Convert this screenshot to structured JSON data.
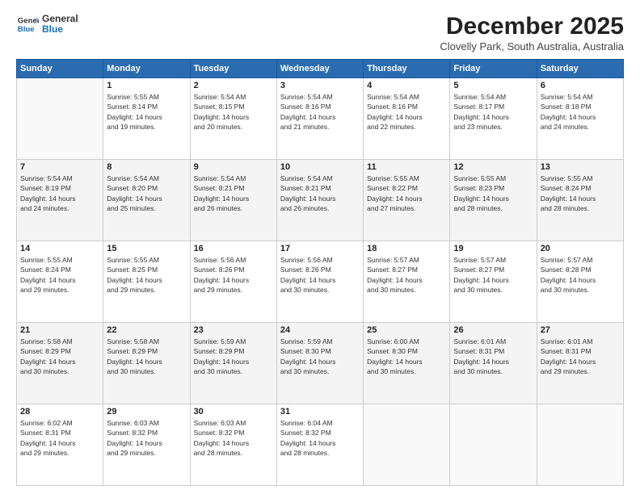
{
  "header": {
    "logo_line1": "General",
    "logo_line2": "Blue",
    "month": "December 2025",
    "location": "Clovelly Park, South Australia, Australia"
  },
  "days_of_week": [
    "Sunday",
    "Monday",
    "Tuesday",
    "Wednesday",
    "Thursday",
    "Friday",
    "Saturday"
  ],
  "weeks": [
    [
      {
        "num": "",
        "info": ""
      },
      {
        "num": "1",
        "info": "Sunrise: 5:55 AM\nSunset: 8:14 PM\nDaylight: 14 hours\nand 19 minutes."
      },
      {
        "num": "2",
        "info": "Sunrise: 5:54 AM\nSunset: 8:15 PM\nDaylight: 14 hours\nand 20 minutes."
      },
      {
        "num": "3",
        "info": "Sunrise: 5:54 AM\nSunset: 8:16 PM\nDaylight: 14 hours\nand 21 minutes."
      },
      {
        "num": "4",
        "info": "Sunrise: 5:54 AM\nSunset: 8:16 PM\nDaylight: 14 hours\nand 22 minutes."
      },
      {
        "num": "5",
        "info": "Sunrise: 5:54 AM\nSunset: 8:17 PM\nDaylight: 14 hours\nand 23 minutes."
      },
      {
        "num": "6",
        "info": "Sunrise: 5:54 AM\nSunset: 8:18 PM\nDaylight: 14 hours\nand 24 minutes."
      }
    ],
    [
      {
        "num": "7",
        "info": "Sunrise: 5:54 AM\nSunset: 8:19 PM\nDaylight: 14 hours\nand 24 minutes."
      },
      {
        "num": "8",
        "info": "Sunrise: 5:54 AM\nSunset: 8:20 PM\nDaylight: 14 hours\nand 25 minutes."
      },
      {
        "num": "9",
        "info": "Sunrise: 5:54 AM\nSunset: 8:21 PM\nDaylight: 14 hours\nand 26 minutes."
      },
      {
        "num": "10",
        "info": "Sunrise: 5:54 AM\nSunset: 8:21 PM\nDaylight: 14 hours\nand 26 minutes."
      },
      {
        "num": "11",
        "info": "Sunrise: 5:55 AM\nSunset: 8:22 PM\nDaylight: 14 hours\nand 27 minutes."
      },
      {
        "num": "12",
        "info": "Sunrise: 5:55 AM\nSunset: 8:23 PM\nDaylight: 14 hours\nand 28 minutes."
      },
      {
        "num": "13",
        "info": "Sunrise: 5:55 AM\nSunset: 8:24 PM\nDaylight: 14 hours\nand 28 minutes."
      }
    ],
    [
      {
        "num": "14",
        "info": "Sunrise: 5:55 AM\nSunset: 8:24 PM\nDaylight: 14 hours\nand 29 minutes."
      },
      {
        "num": "15",
        "info": "Sunrise: 5:55 AM\nSunset: 8:25 PM\nDaylight: 14 hours\nand 29 minutes."
      },
      {
        "num": "16",
        "info": "Sunrise: 5:56 AM\nSunset: 8:26 PM\nDaylight: 14 hours\nand 29 minutes."
      },
      {
        "num": "17",
        "info": "Sunrise: 5:56 AM\nSunset: 8:26 PM\nDaylight: 14 hours\nand 30 minutes."
      },
      {
        "num": "18",
        "info": "Sunrise: 5:57 AM\nSunset: 8:27 PM\nDaylight: 14 hours\nand 30 minutes."
      },
      {
        "num": "19",
        "info": "Sunrise: 5:57 AM\nSunset: 8:27 PM\nDaylight: 14 hours\nand 30 minutes."
      },
      {
        "num": "20",
        "info": "Sunrise: 5:57 AM\nSunset: 8:28 PM\nDaylight: 14 hours\nand 30 minutes."
      }
    ],
    [
      {
        "num": "21",
        "info": "Sunrise: 5:58 AM\nSunset: 8:29 PM\nDaylight: 14 hours\nand 30 minutes."
      },
      {
        "num": "22",
        "info": "Sunrise: 5:58 AM\nSunset: 8:29 PM\nDaylight: 14 hours\nand 30 minutes."
      },
      {
        "num": "23",
        "info": "Sunrise: 5:59 AM\nSunset: 8:29 PM\nDaylight: 14 hours\nand 30 minutes."
      },
      {
        "num": "24",
        "info": "Sunrise: 5:59 AM\nSunset: 8:30 PM\nDaylight: 14 hours\nand 30 minutes."
      },
      {
        "num": "25",
        "info": "Sunrise: 6:00 AM\nSunset: 8:30 PM\nDaylight: 14 hours\nand 30 minutes."
      },
      {
        "num": "26",
        "info": "Sunrise: 6:01 AM\nSunset: 8:31 PM\nDaylight: 14 hours\nand 30 minutes."
      },
      {
        "num": "27",
        "info": "Sunrise: 6:01 AM\nSunset: 8:31 PM\nDaylight: 14 hours\nand 29 minutes."
      }
    ],
    [
      {
        "num": "28",
        "info": "Sunrise: 6:02 AM\nSunset: 8:31 PM\nDaylight: 14 hours\nand 29 minutes."
      },
      {
        "num": "29",
        "info": "Sunrise: 6:03 AM\nSunset: 8:32 PM\nDaylight: 14 hours\nand 29 minutes."
      },
      {
        "num": "30",
        "info": "Sunrise: 6:03 AM\nSunset: 8:32 PM\nDaylight: 14 hours\nand 28 minutes."
      },
      {
        "num": "31",
        "info": "Sunrise: 6:04 AM\nSunset: 8:32 PM\nDaylight: 14 hours\nand 28 minutes."
      },
      {
        "num": "",
        "info": ""
      },
      {
        "num": "",
        "info": ""
      },
      {
        "num": "",
        "info": ""
      }
    ]
  ]
}
